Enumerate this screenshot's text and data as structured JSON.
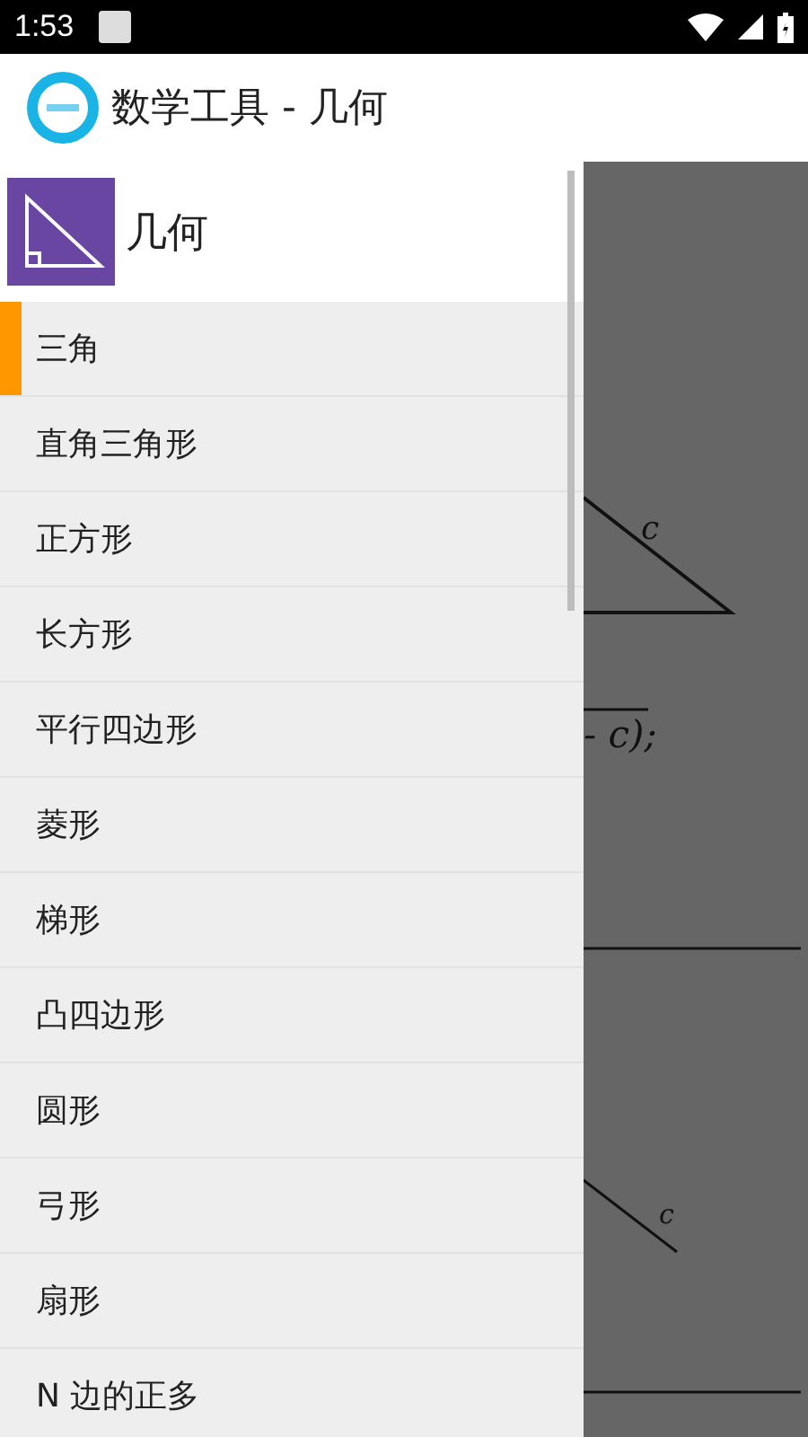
{
  "status_bar": {
    "time": "1:53"
  },
  "app_bar": {
    "title": "数学工具 - 几何"
  },
  "drawer": {
    "header": "几何",
    "items": [
      {
        "label": "三角",
        "selected": true
      },
      {
        "label": "直角三角形",
        "selected": false
      },
      {
        "label": "正方形",
        "selected": false
      },
      {
        "label": "长方形",
        "selected": false
      },
      {
        "label": "平行四边形",
        "selected": false
      },
      {
        "label": "菱形",
        "selected": false
      },
      {
        "label": "梯形",
        "selected": false
      },
      {
        "label": "凸四边形",
        "selected": false
      },
      {
        "label": "圆形",
        "selected": false
      },
      {
        "label": "弓形",
        "selected": false
      },
      {
        "label": "扇形",
        "selected": false
      },
      {
        "label": "N 边的正多",
        "selected": false
      }
    ]
  },
  "content": {
    "labels": [
      "c",
      "c"
    ],
    "formula": "- c);"
  }
}
